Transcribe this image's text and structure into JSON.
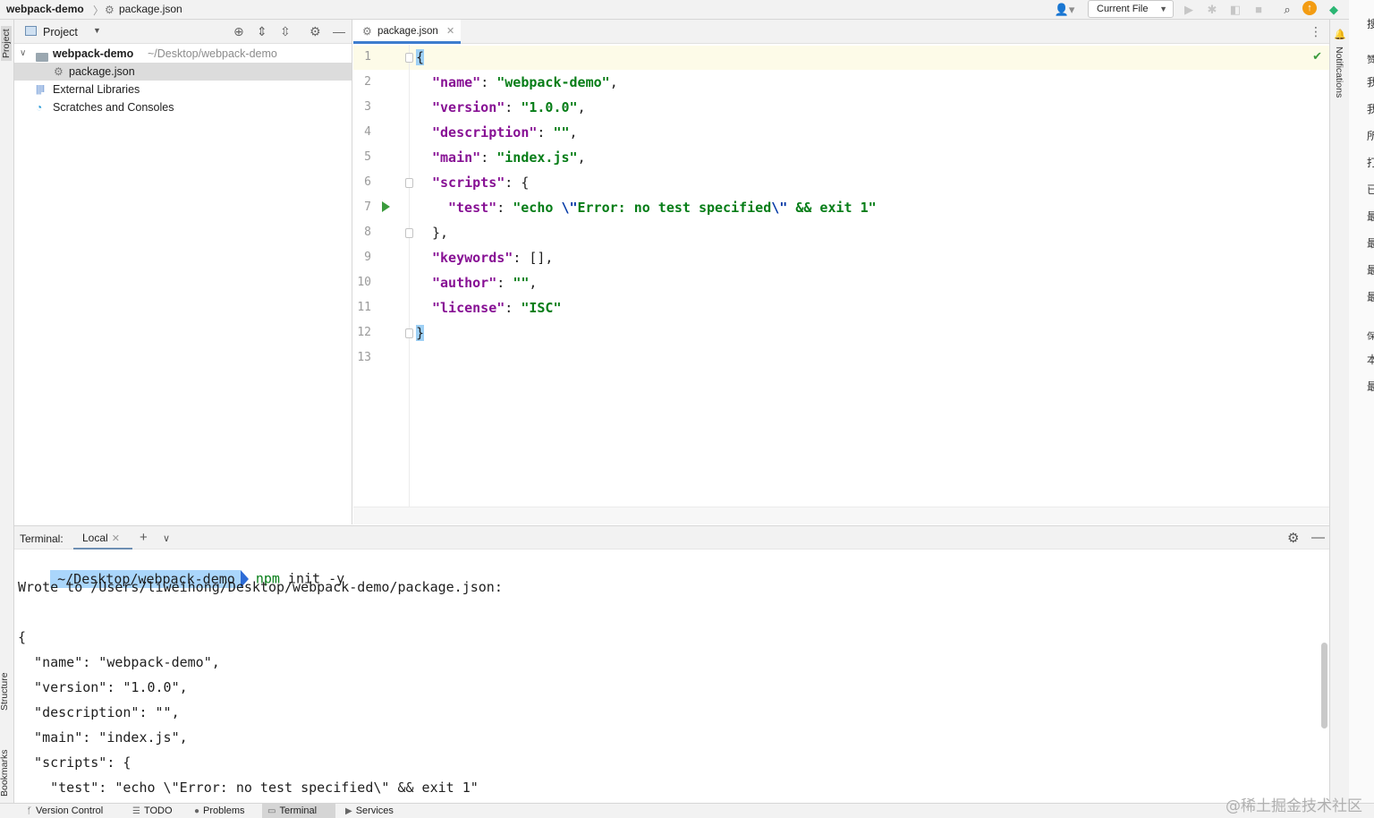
{
  "titlebar": {
    "project": "webpack-demo",
    "separator": "〉",
    "file": "package.json",
    "run_config": "Current File"
  },
  "stripes": {
    "left": [
      "Project",
      "Structure",
      "Bookmarks"
    ],
    "right": [
      "Notifications"
    ]
  },
  "project_panel": {
    "title": "Project",
    "tree": [
      {
        "label": "webpack-demo",
        "path": "~/Desktop/webpack-demo",
        "expanded": true
      },
      {
        "label": "package.json",
        "selected": true
      },
      {
        "label": "External Libraries"
      },
      {
        "label": "Scratches and Consoles"
      }
    ]
  },
  "editor": {
    "tab": "package.json",
    "line_numbers": [
      "1",
      "2",
      "3",
      "4",
      "5",
      "6",
      "7",
      "8",
      "9",
      "10",
      "11",
      "12",
      "13"
    ],
    "lines": [
      {
        "k": "",
        "sep": "",
        "v": "",
        "tail": "{"
      },
      {
        "k": "\"name\"",
        "sep": ": ",
        "v": "\"webpack-demo\"",
        "tail": ","
      },
      {
        "k": "\"version\"",
        "sep": ": ",
        "v": "\"1.0.0\"",
        "tail": ","
      },
      {
        "k": "\"description\"",
        "sep": ": ",
        "v": "\"\"",
        "tail": ","
      },
      {
        "k": "\"main\"",
        "sep": ": ",
        "v": "\"index.js\"",
        "tail": ","
      },
      {
        "k": "\"scripts\"",
        "sep": ": ",
        "v": "",
        "tail": "{"
      },
      {
        "k": "\"test\"",
        "sep": ": ",
        "v1": "\"echo ",
        "esc1": "\\\"",
        "v2": "Error: no test specified",
        "esc2": "\\\"",
        "v3": " && exit 1\""
      },
      {
        "k": "",
        "sep": "",
        "v": "",
        "tail": "},"
      },
      {
        "k": "\"keywords\"",
        "sep": ": ",
        "v": "",
        "tail": "[],"
      },
      {
        "k": "\"author\"",
        "sep": ": ",
        "v": "\"\"",
        "tail": ","
      },
      {
        "k": "\"license\"",
        "sep": ": ",
        "v": "\"ISC\"",
        "tail": ""
      },
      {
        "k": "",
        "sep": "",
        "v": "",
        "tail": "}"
      }
    ]
  },
  "terminal": {
    "label": "Terminal:",
    "tab": "Local",
    "prompt_path": "~/Desktop/webpack-demo",
    "cmd_bin": "npm",
    "cmd_args": " init -y",
    "output": [
      "Wrote to /Users/liweihong/Desktop/webpack-demo/package.json:",
      "",
      "{",
      "  \"name\": \"webpack-demo\",",
      "  \"version\": \"1.0.0\",",
      "  \"description\": \"\",",
      "  \"main\": \"index.js\",",
      "  \"scripts\": {",
      "    \"test\": \"echo \\\"Error: no test specified\\\" && exit 1\""
    ]
  },
  "statusbar": {
    "items": [
      "Version Control",
      "TODO",
      "Problems",
      "Terminal",
      "Services"
    ],
    "active": "Terminal"
  },
  "right_cjk": [
    "搜",
    "赞",
    "我",
    "我",
    "所",
    "打",
    "已",
    "最",
    "最",
    "最",
    "最",
    "保",
    "本",
    "最"
  ],
  "watermark": "@稀土掘金技术社区",
  "colors": {
    "accent": "#3d7cce",
    "json_key": "#871094",
    "json_string": "#067d17",
    "prompt_bg": "#aad6fb",
    "current_line": "#fdfbe8"
  }
}
